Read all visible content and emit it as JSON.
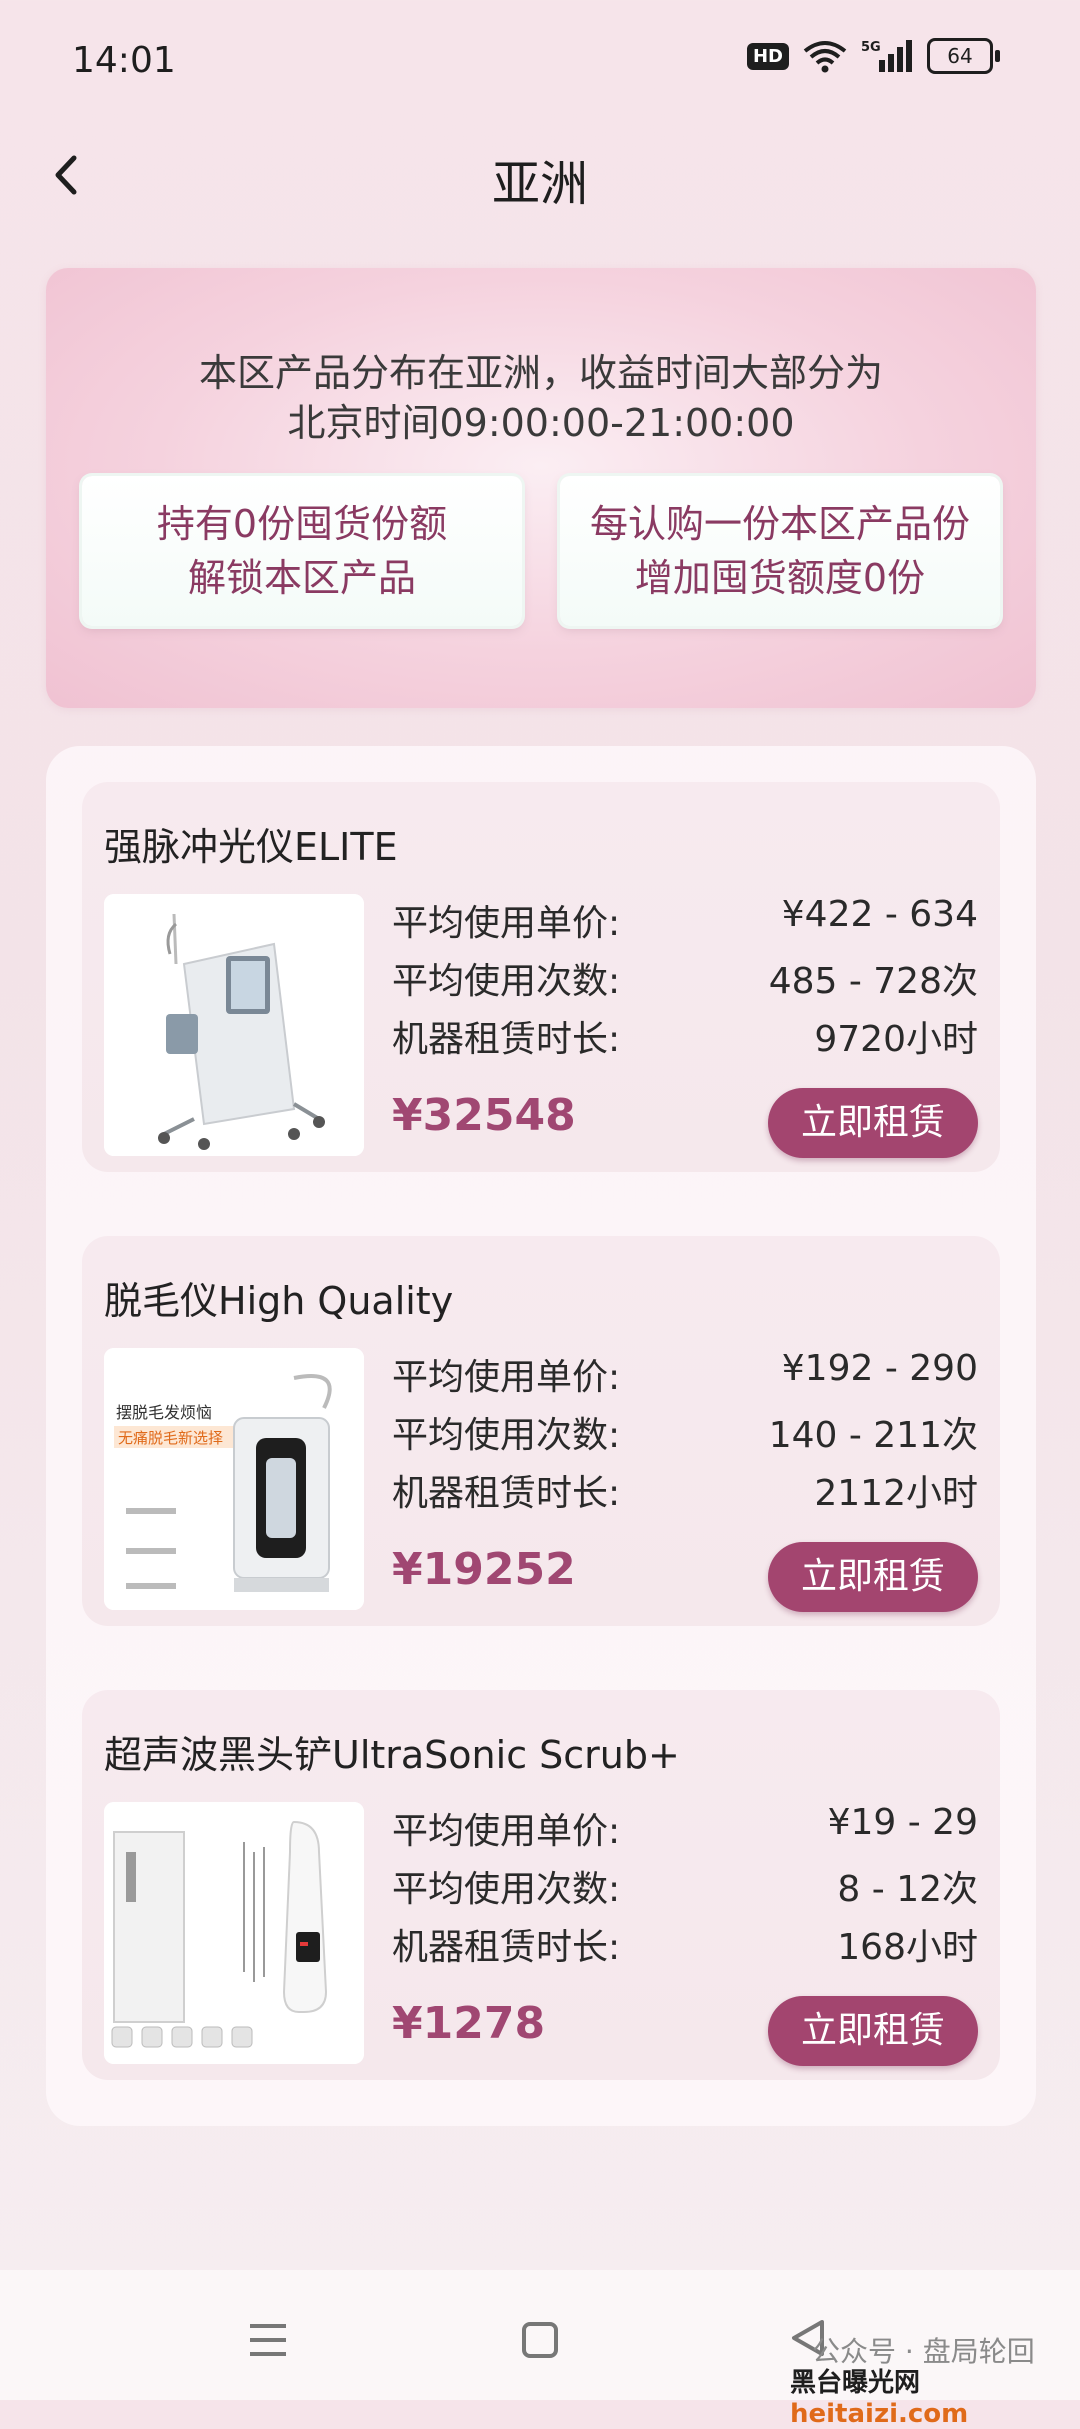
{
  "status_bar": {
    "time": "14:01",
    "hd": "HD",
    "network": "5G",
    "battery": "64"
  },
  "header": {
    "title": "亚洲"
  },
  "banner": {
    "line1": "本区产品分布在亚洲，收益时间大部分为",
    "line2": "北京时间09:00:00-21:00:00",
    "quota_left": {
      "line1": "持有0份囤货份额",
      "line2": "解锁本区产品"
    },
    "quota_right": {
      "line1": "每认购一份本区产品份",
      "line2": "增加囤货额度0份"
    }
  },
  "products": [
    {
      "name": "强脉冲光仪ELITE",
      "specs": [
        {
          "label": "平均使用单价:",
          "value": "¥422 - 634"
        },
        {
          "label": "平均使用次数:",
          "value": "485 - 728次"
        },
        {
          "label": "机器租赁时长:",
          "value": "9720小时"
        }
      ],
      "price": "¥32548",
      "button": "立即租赁"
    },
    {
      "name": "脱毛仪High Quality",
      "specs": [
        {
          "label": "平均使用单价:",
          "value": "¥192 - 290"
        },
        {
          "label": "平均使用次数:",
          "value": "140 - 211次"
        },
        {
          "label": "机器租赁时长:",
          "value": "2112小时"
        }
      ],
      "price": "¥19252",
      "button": "立即租赁",
      "image_text": {
        "t1": "摆脱毛发烦恼",
        "t2": "无痛脱毛新选择"
      }
    },
    {
      "name": "超声波黑头铲UltraSonic Scrub+",
      "specs": [
        {
          "label": "平均使用单价:",
          "value": "¥19 - 29"
        },
        {
          "label": "平均使用次数:",
          "value": "8 - 12次"
        },
        {
          "label": "机器租赁时长:",
          "value": "168小时"
        }
      ],
      "price": "¥1278",
      "button": "立即租赁"
    }
  ],
  "watermark": {
    "line1": "公众号 · 盘局轮回",
    "site_cn": "黑台曝光网",
    "site_en": "heitaizi.com"
  },
  "colors": {
    "accent": "#a3456f",
    "price": "#a04772",
    "quota_text": "#8a3a62"
  }
}
